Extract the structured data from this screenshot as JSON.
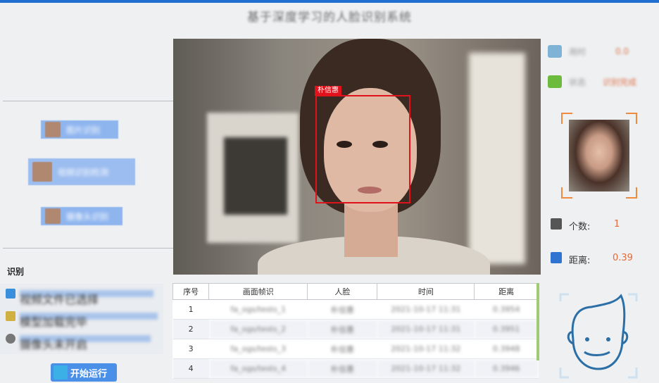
{
  "window": {
    "title": "基于深度学习的人脸识别系统"
  },
  "nav": {
    "buttons": [
      {
        "label": "图片识别"
      },
      {
        "label": "视频识别检测"
      },
      {
        "label": "摄像头识别"
      }
    ]
  },
  "video": {
    "detection_label": "朴信惠"
  },
  "stats": {
    "rows": [
      {
        "icon": "monitor-icon",
        "label": "用时",
        "value": "0.0"
      },
      {
        "icon": "battery-icon",
        "label": "状态",
        "value": "识别完成"
      }
    ],
    "count_label": "个数:",
    "count_value": "1",
    "distance_label": "距离:",
    "distance_value": "0.39"
  },
  "log": {
    "tab_label": "识别",
    "rows": [
      {
        "icon": "video-icon",
        "text": "视频文件已选择"
      },
      {
        "icon": "folder-icon",
        "text": "模型加载完毕"
      },
      {
        "icon": "camera-icon",
        "text": "摄像头未开启"
      }
    ]
  },
  "start_button": {
    "label": "开始运行"
  },
  "table": {
    "headers": [
      "序号",
      "画面帧识",
      "人脸",
      "时间",
      "距离"
    ],
    "rows": [
      [
        "1",
        "fa_ogs/tests_1",
        "朴信惠",
        "2021-10-17 11:31",
        "0.3954"
      ],
      [
        "2",
        "fa_ogs/tests_2",
        "朴信惠",
        "2021-10-17 11:31",
        "0.3951"
      ],
      [
        "3",
        "fa_ogs/tests_3",
        "朴信惠",
        "2021-10-17 11:32",
        "0.3948"
      ],
      [
        "4",
        "fa_ogs/tests_4",
        "朴信惠",
        "2021-10-17 11:32",
        "0.3946"
      ]
    ]
  },
  "colors": {
    "accent": "#1f6fd0",
    "bbox": "#e0121b",
    "value": "#e06b3c",
    "highlight": "#f08a3c"
  }
}
